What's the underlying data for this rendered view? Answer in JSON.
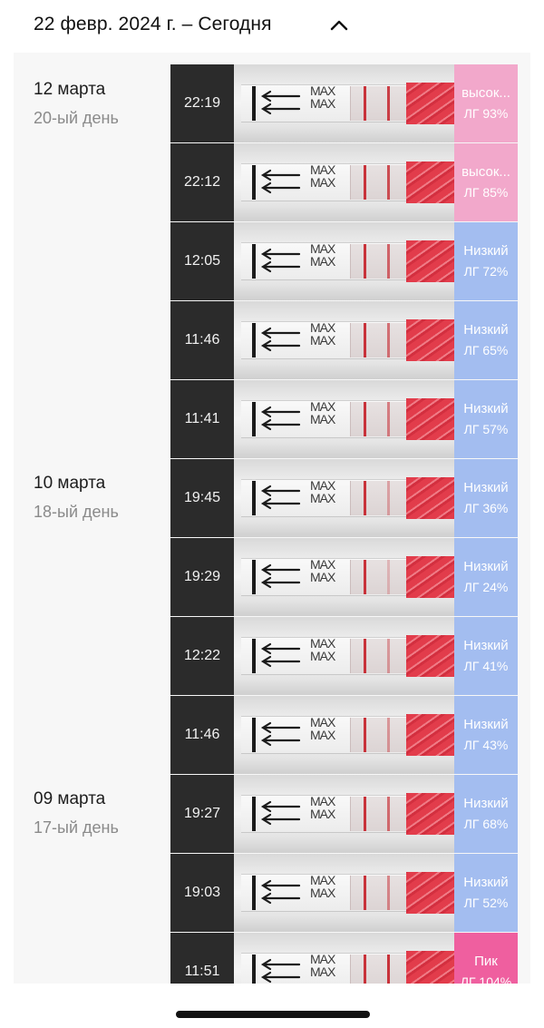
{
  "header": {
    "title": "22 февр. 2024 г. – Сегодня",
    "toggle_icon": "chevron-up-icon"
  },
  "days": [
    {
      "date": "12 марта",
      "cycle_day": "20-ый день"
    },
    {
      "date": "10 марта",
      "cycle_day": "18-ый день"
    },
    {
      "date": "09 марта",
      "cycle_day": "17-ый день"
    }
  ],
  "strip_label": "MAX",
  "colors": {
    "high": "#f2a8cb",
    "low": "#a3bdf0",
    "peak": "#ef5f9f",
    "time_bg": "#2b2b2b"
  },
  "results": [
    {
      "time": "22:19",
      "level": "высок...",
      "lh": "ЛГ 93%",
      "status": "high",
      "lh_percent": 93
    },
    {
      "time": "22:12",
      "level": "высок...",
      "lh": "ЛГ 85%",
      "status": "high",
      "lh_percent": 85
    },
    {
      "time": "12:05",
      "level": "Низкий",
      "lh": "ЛГ 72%",
      "status": "low",
      "lh_percent": 72
    },
    {
      "time": "11:46",
      "level": "Низкий",
      "lh": "ЛГ 65%",
      "status": "low",
      "lh_percent": 65
    },
    {
      "time": "11:41",
      "level": "Низкий",
      "lh": "ЛГ 57%",
      "status": "low",
      "lh_percent": 57
    },
    {
      "time": "19:45",
      "level": "Низкий",
      "lh": "ЛГ 36%",
      "status": "low",
      "lh_percent": 36
    },
    {
      "time": "19:29",
      "level": "Низкий",
      "lh": "ЛГ 24%",
      "status": "low",
      "lh_percent": 24
    },
    {
      "time": "12:22",
      "level": "Низкий",
      "lh": "ЛГ 41%",
      "status": "low",
      "lh_percent": 41
    },
    {
      "time": "11:46",
      "level": "Низкий",
      "lh": "ЛГ 43%",
      "status": "low",
      "lh_percent": 43
    },
    {
      "time": "19:27",
      "level": "Низкий",
      "lh": "ЛГ 68%",
      "status": "low",
      "lh_percent": 68
    },
    {
      "time": "19:03",
      "level": "Низкий",
      "lh": "ЛГ 52%",
      "status": "low",
      "lh_percent": 52
    },
    {
      "time": "11:51",
      "level": "Пик",
      "lh": "ЛГ 104%",
      "status": "peak",
      "lh_percent": 104
    }
  ]
}
